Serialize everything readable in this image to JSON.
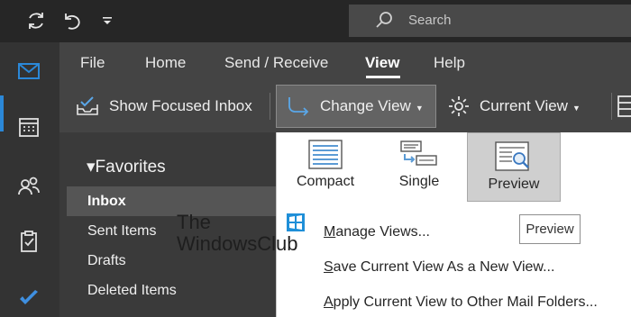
{
  "titlebar": {
    "icons": [
      "sync-icon",
      "undo-icon",
      "customize-quick-access-icon"
    ],
    "search": {
      "placeholder": "Search"
    }
  },
  "left_rail": {
    "items": [
      "mail-icon",
      "calendar-icon",
      "people-icon",
      "tasks-icon",
      "todo-icon"
    ],
    "active": "mail-icon"
  },
  "menu": {
    "tabs": [
      {
        "label": "File"
      },
      {
        "label": "Home"
      },
      {
        "label": "Send / Receive"
      },
      {
        "label": "View",
        "active": true
      },
      {
        "label": "Help"
      }
    ]
  },
  "ribbon": {
    "show_focused_inbox": "Show Focused Inbox",
    "change_view": "Change View",
    "current_view": "Current View"
  },
  "folders": {
    "header": "Favorites",
    "items": [
      "Inbox",
      "Sent Items",
      "Drafts",
      "Deleted Items"
    ],
    "selected": "Inbox"
  },
  "change_view_menu": {
    "options": [
      {
        "label": "Compact",
        "icon": "compact-view-icon"
      },
      {
        "label": "Single",
        "icon": "single-view-icon"
      },
      {
        "label": "Preview",
        "icon": "preview-view-icon",
        "selected": true
      }
    ],
    "items": [
      {
        "underline": "M",
        "rest": "anage Views..."
      },
      {
        "underline": "S",
        "rest": "ave Current View As a New View..."
      },
      {
        "underline": "A",
        "rest": "pply Current View to Other Mail Folders..."
      }
    ],
    "tooltip": "Preview"
  },
  "watermark": {
    "line1": "The",
    "line2": "WindowsClub"
  },
  "colors": {
    "titlebar": "#262626",
    "ribbon": "#444444",
    "left_rail": "#333333",
    "folder_pane": "#3a3a3a",
    "accent": "#2b88d8",
    "selected_option": "#cfcfcf"
  }
}
